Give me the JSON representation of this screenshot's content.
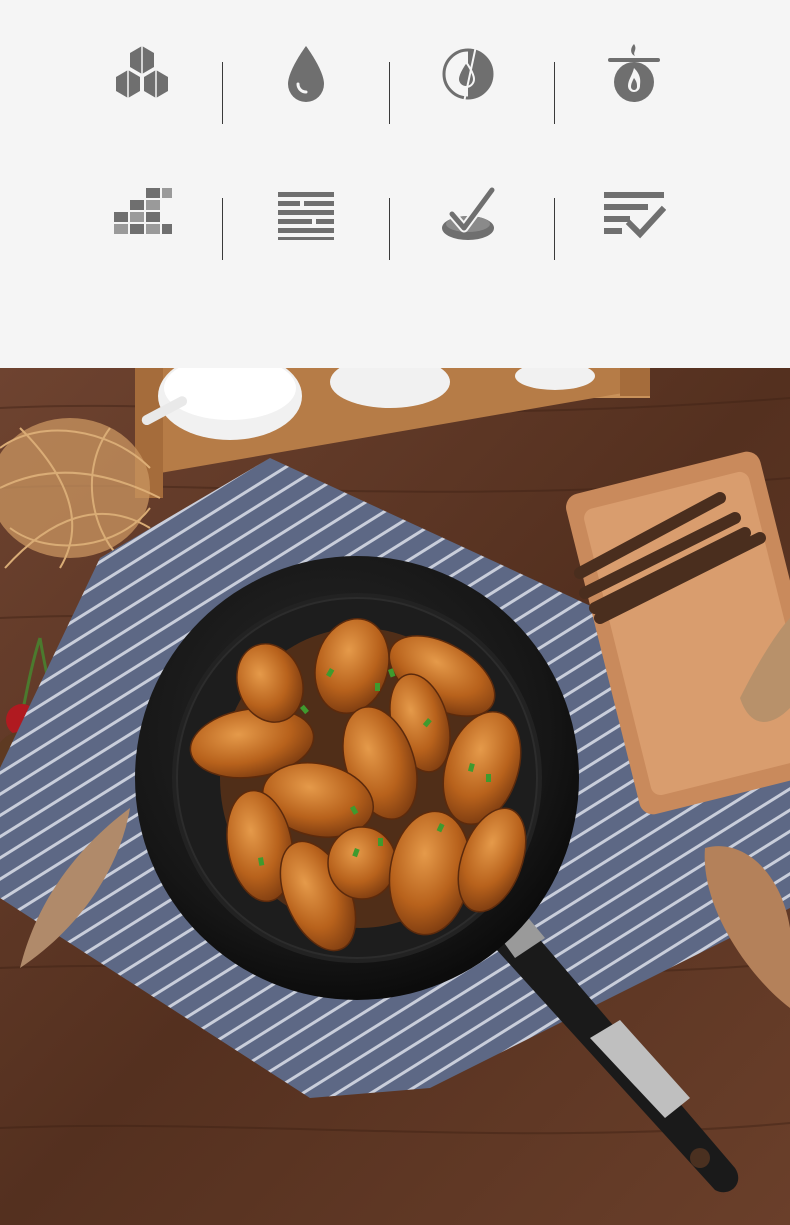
{
  "features": {
    "row1": [
      {
        "icon": "molecule-hexagons-icon",
        "caption": ""
      },
      {
        "icon": "water-drop-icon",
        "caption": ""
      },
      {
        "icon": "half-circle-drop-icon",
        "caption": ""
      },
      {
        "icon": "flame-pan-icon",
        "caption": ""
      }
    ],
    "row2": [
      {
        "icon": "grid-blocks-icon",
        "caption": ""
      },
      {
        "icon": "layers-lines-icon",
        "caption": ""
      },
      {
        "icon": "check-bowl-icon",
        "caption": ""
      },
      {
        "icon": "list-check-icon",
        "caption": ""
      }
    ]
  },
  "colors": {
    "icon_gray": "#6f6f6f",
    "panel_bg": "#f5f5f5",
    "wood": "#5a3524",
    "towel": "#5f6a86",
    "pan": "#1c1c1c",
    "wings": "#b8621c"
  },
  "photo": {
    "description_hidden": "",
    "subject": "frying-pan-with-chicken-wings"
  }
}
